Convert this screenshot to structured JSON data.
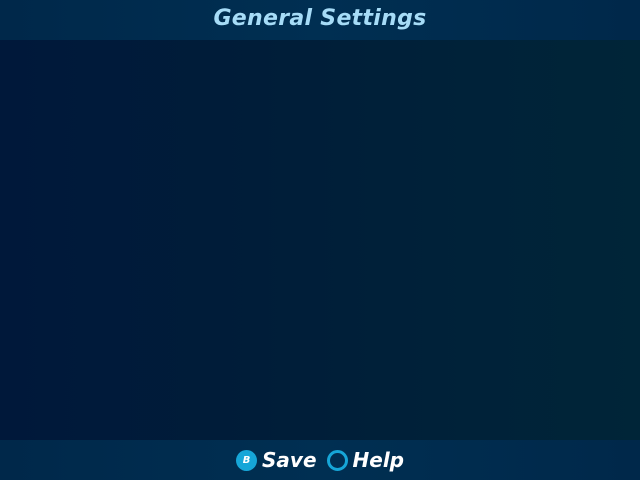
{
  "header": {
    "title": "General Settings"
  },
  "footer": {
    "actions": [
      {
        "button_glyph": "B",
        "icon": "b-button-icon",
        "label": "Save"
      },
      {
        "button_glyph": "",
        "icon": "circle-button-icon",
        "label": "Help"
      }
    ]
  },
  "colors": {
    "accent": "#16a6d8",
    "title_text": "#a6dcf7",
    "bar_background": "#002f52",
    "content_background": "#001d39"
  }
}
